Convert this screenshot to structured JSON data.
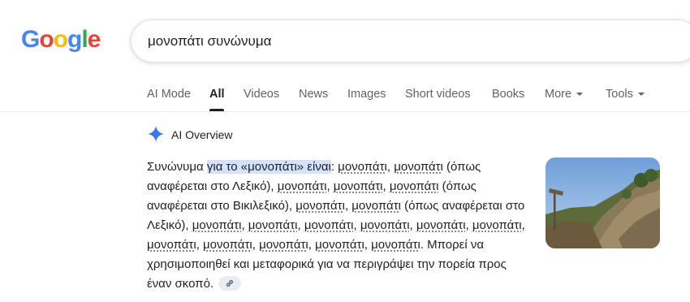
{
  "logo": {
    "text": "Google"
  },
  "search": {
    "query": "μονοπάτι συνώνυμα"
  },
  "tabs": [
    {
      "label": "AI Mode"
    },
    {
      "label": "All"
    },
    {
      "label": "Videos"
    },
    {
      "label": "News"
    },
    {
      "label": "Images"
    },
    {
      "label": "Short videos"
    },
    {
      "label": "Books"
    },
    {
      "label": "More"
    }
  ],
  "tools": {
    "label": "Tools"
  },
  "ai_overview": {
    "title": "AI Overview",
    "intro": "Συνώνυμα ",
    "highlight": "για το «μονοπάτι» είναι",
    "colon": ": ",
    "lead_word": "μονοπάτι",
    "sep": ", ",
    "paren_wiki": " (όπως αναφέρεται στο Λεξικό), ",
    "paren_vik": " (όπως αναφέρεται στο Βικιλεξικό), ",
    "paren_lex": " (όπως αναφέρεται στο Λεξικό), ",
    "trailing": ". Μπορεί να χρησιμοποιηθεί και μεταφορικά για να περιγράψει την πορεία προς έναν σκοπό."
  },
  "colors": {
    "accent": "#1a73e8",
    "highlight": "#d3e3fd",
    "muted": "#5f6368"
  }
}
